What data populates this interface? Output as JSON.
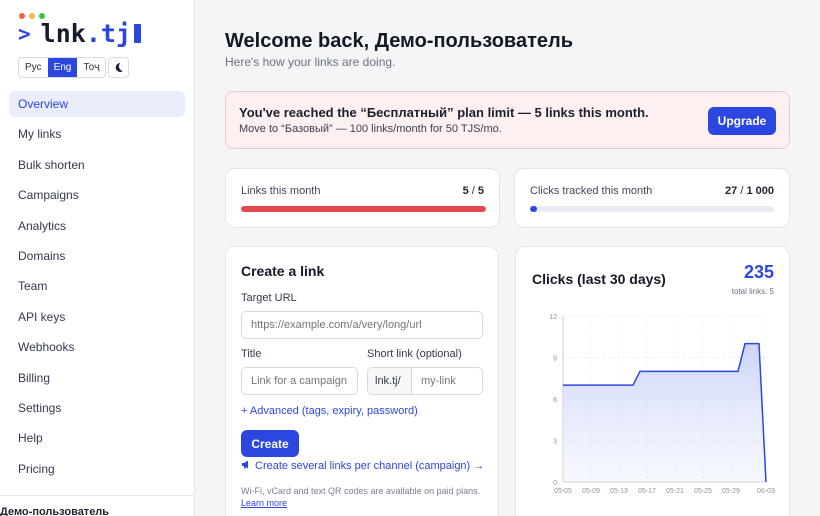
{
  "window": {
    "dot_colors": [
      "#f25f57",
      "#f6b93b",
      "#35c44b"
    ]
  },
  "brand": {
    "prompt": ">",
    "name": "lnk",
    "tld": ".tj",
    "accent": "#2c46e0"
  },
  "languages": [
    {
      "label": "Рус",
      "active": false
    },
    {
      "label": "Eng",
      "active": true
    },
    {
      "label": "Тоҷ",
      "active": false
    }
  ],
  "theme_toggle": {
    "icon": "moon-icon"
  },
  "sidebar": {
    "items": [
      {
        "label": "Overview",
        "active": true
      },
      {
        "label": "My links"
      },
      {
        "label": "Bulk shorten"
      },
      {
        "label": "Campaigns"
      },
      {
        "label": "Analytics"
      },
      {
        "label": "Domains"
      },
      {
        "label": "Team"
      },
      {
        "label": "API keys"
      },
      {
        "label": "Webhooks"
      },
      {
        "label": "Billing"
      },
      {
        "label": "Settings"
      },
      {
        "label": "Help"
      },
      {
        "label": "Pricing"
      }
    ],
    "user_name": "Демо-пользователь"
  },
  "main": {
    "title": "Welcome back, Демо-пользователь",
    "subtitle": "Here's how your links are doing."
  },
  "alert": {
    "title": "You've reached the “Бесплатный” plan limit — 5 links this month.",
    "text": "Move to “Базовый” — 100 links/month for 50 TJS/mo.",
    "button": "Upgrade"
  },
  "stats": {
    "links": {
      "label": "Links this month",
      "used": "5",
      "sep": " / ",
      "limit": "5",
      "fraction": 1.0,
      "color": "#e5484d"
    },
    "clicks": {
      "label": "Clicks tracked this month",
      "used": "27",
      "sep": " / ",
      "limit": "1 000",
      "fraction": 0.027,
      "color": "#2c46e0"
    }
  },
  "create_link": {
    "title": "Create a link",
    "target_label": "Target URL",
    "target_placeholder": "https://example.com/a/very/long/url",
    "title_label": "Title",
    "title_placeholder": "Link for a campaign",
    "short_label": "Short link (optional)",
    "short_prefix": "lnk.tj/",
    "short_placeholder": "my-link",
    "advanced": "+ Advanced (tags, expiry, password)",
    "button": "Create",
    "campaign_link": "Create several links per channel (campaign) →",
    "note": "Wi-Fi, vCard and text QR codes are available on paid plans.",
    "note_link": "Learn more"
  },
  "chart_card": {
    "title": "Clicks (last 30 days)",
    "total": "235",
    "total_sub": "total links: 5"
  },
  "chart_data": {
    "type": "area",
    "title": "Clicks (last 30 days)",
    "x": [
      "05-05",
      "05-06",
      "05-07",
      "05-08",
      "05-09",
      "05-10",
      "05-11",
      "05-12",
      "05-13",
      "05-14",
      "05-15",
      "05-16",
      "05-17",
      "05-18",
      "05-19",
      "05-20",
      "05-21",
      "05-22",
      "05-23",
      "05-24",
      "05-25",
      "05-26",
      "05-27",
      "05-28",
      "05-29",
      "05-30",
      "05-31",
      "06-01",
      "06-02",
      "06-03"
    ],
    "xticks": [
      "05-05",
      "05-09",
      "05-13",
      "05-17",
      "05-21",
      "05-25",
      "05-29",
      "06-03"
    ],
    "series": [
      {
        "values": [
          7,
          7,
          7,
          7,
          7,
          7,
          7,
          7,
          7,
          7,
          7,
          8,
          8,
          8,
          8,
          8,
          8,
          8,
          8,
          8,
          8,
          8,
          8,
          8,
          8,
          8,
          10,
          10,
          10,
          0
        ]
      }
    ],
    "ylim": [
      0,
      12
    ],
    "yticks": [
      0,
      3,
      6,
      9,
      12
    ],
    "grid": true,
    "line_color": "#2c46e0"
  }
}
